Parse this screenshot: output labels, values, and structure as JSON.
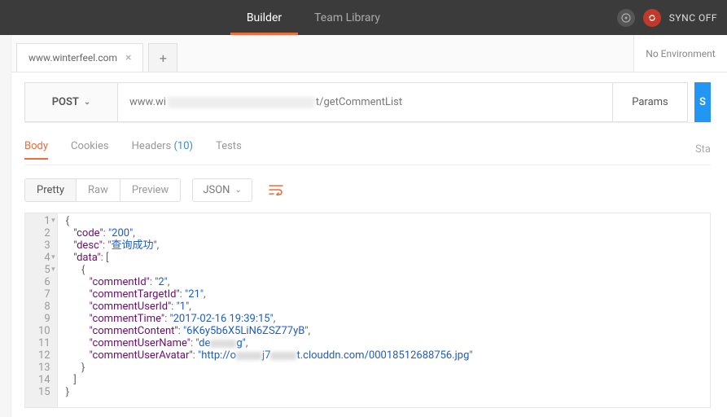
{
  "header": {
    "tabs": [
      {
        "label": "Builder",
        "active": true
      },
      {
        "label": "Team Library",
        "active": false
      }
    ],
    "sync_label": "SYNC OFF"
  },
  "request_tabs": [
    {
      "label": "www.winterfeel.com"
    }
  ],
  "environment": {
    "label": "No Environment"
  },
  "request": {
    "method": "POST",
    "url_prefix": "www.wi",
    "url_suffix": "t/getCommentList",
    "params_label": "Params",
    "send_label": "S"
  },
  "subtabs": {
    "items": [
      {
        "label": "Body",
        "active": true
      },
      {
        "label": "Cookies",
        "active": false
      },
      {
        "label": "Headers",
        "count": "(10)",
        "active": false
      },
      {
        "label": "Tests",
        "active": false
      }
    ],
    "status_right": "Sta"
  },
  "view": {
    "modes": [
      {
        "label": "Pretty",
        "active": true
      },
      {
        "label": "Raw",
        "active": false
      },
      {
        "label": "Preview",
        "active": false
      }
    ],
    "format": "JSON"
  },
  "response_json": {
    "code": "200",
    "desc": "查询成功",
    "data": [
      {
        "commentId": "2",
        "commentTargetId": "21",
        "commentUserId": "1",
        "commentTime": "2017-02-16 19:39:15",
        "commentContent": "6K6y5b6X5LiN6ZSZ77yB",
        "commentUserName_prefix": "de",
        "commentUserName_suffix": "g",
        "commentUserAvatar_prefix": "http://o",
        "commentUserAvatar_mid": "j7",
        "commentUserAvatar_suffix": "t.clouddn.com/00018512688756.jpg"
      }
    ]
  },
  "line_count": 15
}
